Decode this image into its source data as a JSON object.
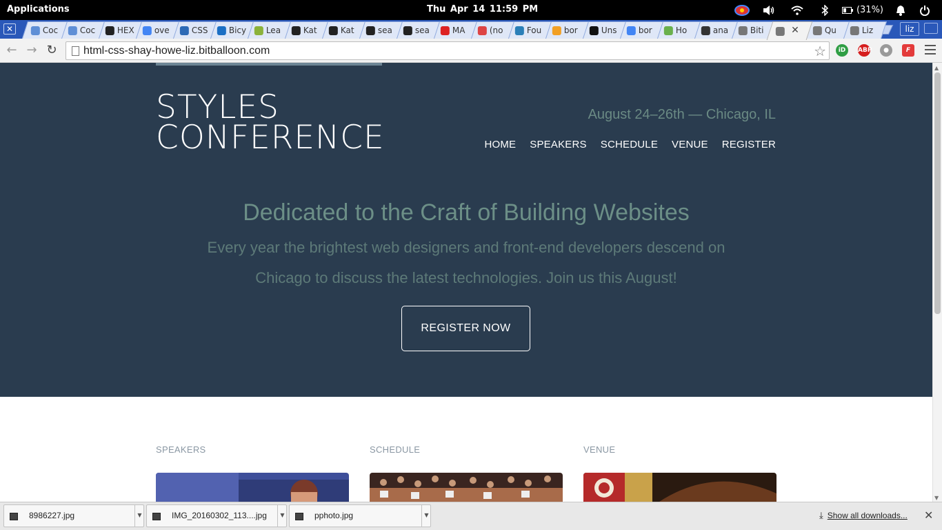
{
  "system": {
    "apps_label": "Applications",
    "clock": "Thu Apr 14   11:59 PM",
    "battery": "(31%)"
  },
  "tabs": [
    {
      "label": "Coc",
      "color": "#5f8fd6"
    },
    {
      "label": "Coc",
      "color": "#5f8fd6"
    },
    {
      "label": "HEX",
      "color": "#222222"
    },
    {
      "label": "ove",
      "color": "#4285f4"
    },
    {
      "label": "CSS",
      "color": "#2d6ab5"
    },
    {
      "label": "Bicy",
      "color": "#1b6fc4"
    },
    {
      "label": "Lea",
      "color": "#8bb23a"
    },
    {
      "label": "Kat",
      "color": "#222222"
    },
    {
      "label": "Kat",
      "color": "#222222"
    },
    {
      "label": "sea",
      "color": "#222222"
    },
    {
      "label": "sea",
      "color": "#222222"
    },
    {
      "label": "MA",
      "color": "#d22"
    },
    {
      "label": "(no",
      "color": "#d44"
    },
    {
      "label": "Fou",
      "color": "#2a7fb8"
    },
    {
      "label": "bor",
      "color": "#f2a023"
    },
    {
      "label": "Uns",
      "color": "#111"
    },
    {
      "label": "bor",
      "color": "#4285f4"
    },
    {
      "label": "Ho",
      "color": "#6ab04c"
    },
    {
      "label": "ana",
      "color": "#333"
    },
    {
      "label": "Biti",
      "color": "#777"
    },
    {
      "label": "",
      "color": "#777",
      "active": true
    },
    {
      "label": "Qu",
      "color": "#777"
    },
    {
      "label": "Liz",
      "color": "#777"
    }
  ],
  "user_chip": "liz",
  "omnibox": {
    "url": "html-css-shay-howe-liz.bitballoon.com"
  },
  "site": {
    "logo_line1": "STYLES",
    "logo_line2": "CONFERENCE",
    "dateline": "August 24–26th — Chicago, IL",
    "nav": [
      "HOME",
      "SPEAKERS",
      "SCHEDULE",
      "VENUE",
      "REGISTER"
    ],
    "hero_title": "Dedicated to the Craft of Building Websites",
    "hero_text": "Every year the brightest web designers and front-end developers descend on Chicago to discuss the latest technologies. Join us this August!",
    "cta": "REGISTER NOW",
    "columns": [
      "SPEAKERS",
      "SCHEDULE",
      "VENUE"
    ],
    "hero_bg": "#2a3c4f"
  },
  "downloads": {
    "items": [
      "8986227.jpg",
      "IMG_20160302_113....jpg",
      "pphoto.jpg"
    ],
    "show_all": "Show all downloads..."
  }
}
